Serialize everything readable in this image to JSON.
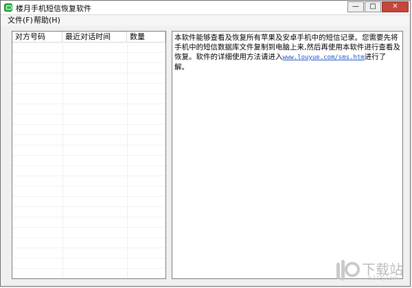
{
  "window": {
    "title": "楼月手机短信恢复软件",
    "controls": {
      "minimize_glyph": "—",
      "maximize_glyph": "□",
      "close_glyph": "✕"
    }
  },
  "menu": {
    "items": [
      {
        "label": "文件(F)"
      },
      {
        "label": "帮助(H)"
      }
    ]
  },
  "conversation_list": {
    "columns": [
      {
        "label": "对方号码"
      },
      {
        "label": "最近对话时间"
      },
      {
        "label": "数量"
      }
    ],
    "rows": []
  },
  "info_panel": {
    "text_part1": "本软件能够查看及恢复所有苹果及安卓手机中的短信记录。您需要先将手机中的短信数据库文件复制到电脑上来,然后再使用本软件进行查看及恢复。软件的详细使用方法请进入",
    "link_text": "www.louyue.com/sms.htm",
    "text_part2": "进行了解。"
  },
  "watermark": {
    "text": "下载站",
    "url": "d.119j.com"
  },
  "colors": {
    "link": "#1a55c9",
    "close_button": "#c7463c",
    "app_icon": "#2eb24a"
  }
}
